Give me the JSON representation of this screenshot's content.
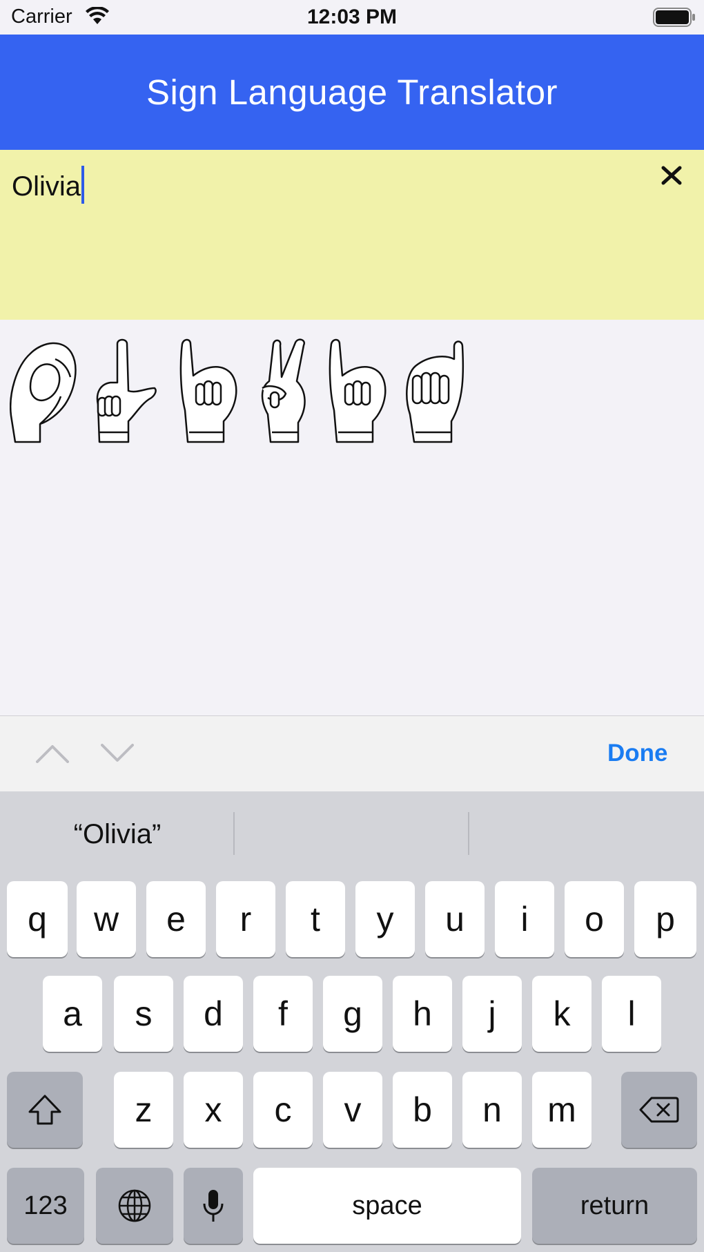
{
  "status_bar": {
    "carrier": "Carrier",
    "time": "12:03 PM"
  },
  "header": {
    "title": "Sign Language Translator"
  },
  "input": {
    "value": "Olivia"
  },
  "signs": [
    "O",
    "L",
    "I",
    "V",
    "I",
    "A"
  ],
  "toolbar": {
    "done_label": "Done"
  },
  "keyboard": {
    "suggestions": [
      "“Olivia”",
      "",
      ""
    ],
    "row1": [
      "q",
      "w",
      "e",
      "r",
      "t",
      "y",
      "u",
      "i",
      "o",
      "p"
    ],
    "row2": [
      "a",
      "s",
      "d",
      "f",
      "g",
      "h",
      "j",
      "k",
      "l"
    ],
    "row3": [
      "z",
      "x",
      "c",
      "v",
      "b",
      "n",
      "m"
    ],
    "numbers_label": "123",
    "space_label": "space",
    "return_label": "return"
  },
  "colors": {
    "header": "#3563f1",
    "text_panel": "#f1f2aa",
    "accent": "#1a7cf2"
  }
}
